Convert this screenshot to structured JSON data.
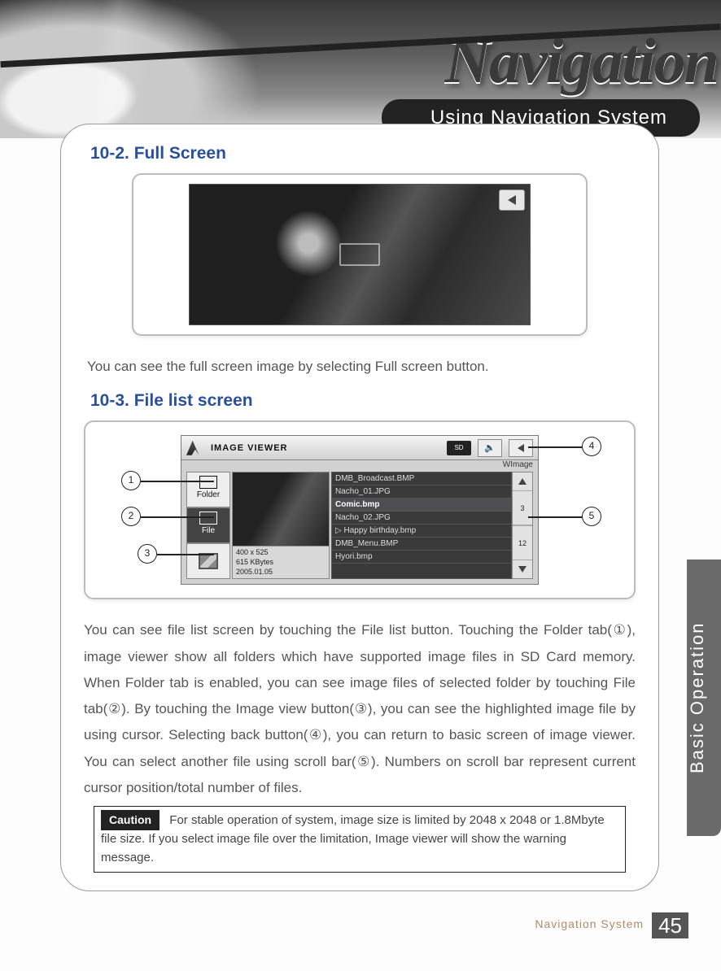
{
  "hero": {
    "brand": "Navigation",
    "subtitle": "Using Navigation System"
  },
  "side_tab": "Basic Operation",
  "footer": {
    "label": "Navigation System",
    "page": "45"
  },
  "section_a": {
    "title": "10-2. Full Screen",
    "body": "You can see the full screen image by selecting Full screen button."
  },
  "section_b": {
    "title": "10-3. File list screen",
    "body": "You can see file list screen by touching the File list button. Touching the Folder tab(①), image viewer show all folders which have supported image files in SD Card memory. When Folder tab is enabled, you can see image files of selected folder by touching File tab(②). By touching the Image view button(③), you can see the highlighted image file by using cursor. Selecting back button(④), you can return to basic screen of image viewer. You can select another file using scroll bar(⑤). Numbers on scroll bar represent current cursor position/total number of files."
  },
  "caution": {
    "tag": "Caution",
    "text": "For stable operation of system, image size is limited by 2048 x 2048 or 1.8Mbyte file size. If you select image file over the limitation, Image viewer will show the warning message."
  },
  "filelist": {
    "app_title": "IMAGE VIEWER",
    "sd_label": "SD",
    "wimage": "WImage",
    "tabs": {
      "folder": "Folder",
      "file": "File"
    },
    "meta": {
      "dim": "400 x 525",
      "size": "615 KBytes",
      "date": "2005.01.05"
    },
    "items": [
      "DMB_Broadcast.BMP",
      "Nacho_01.JPG",
      "Comic.bmp",
      "Nacho_02.JPG",
      "Happy birthday.bmp",
      "DMB_Menu.BMP",
      "Hyori.bmp"
    ],
    "selected_index": 2,
    "playing_index": 4,
    "scroll": {
      "pos": "3",
      "total": "12"
    }
  },
  "callouts": {
    "c1": "1",
    "c2": "2",
    "c3": "3",
    "c4": "4",
    "c5": "5"
  }
}
